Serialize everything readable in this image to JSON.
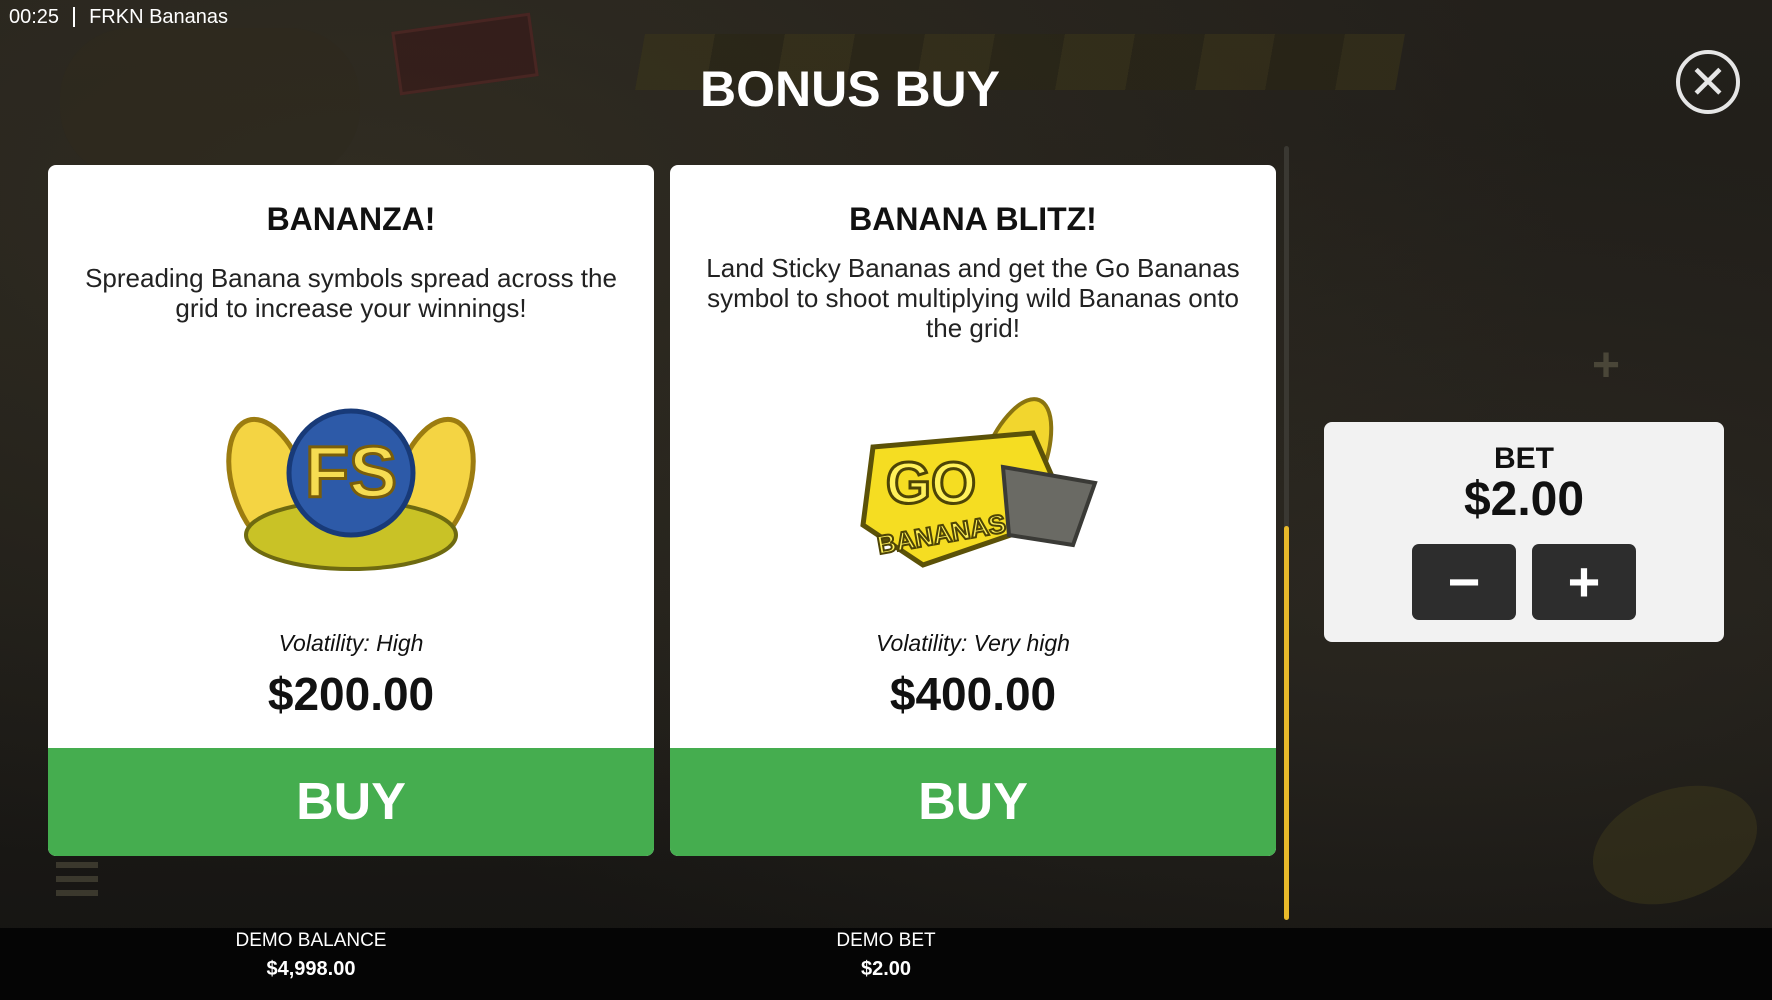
{
  "status_bar": {
    "time": "00:25",
    "app_title": "FRKN Bananas"
  },
  "modal": {
    "title": "BONUS BUY",
    "close_icon": "close-circle-icon"
  },
  "bonus_cards": [
    {
      "name": "BANANZA!",
      "description": "Spreading Banana symbols spread across the grid to increase your winnings!",
      "art_icon": "fs-banana-badge-icon",
      "art_text": "FS",
      "volatility": "Volatility: High",
      "price": "$200.00",
      "buy_label": "BUY"
    },
    {
      "name": "BANANA BLITZ!",
      "description": "Land Sticky Bananas and get the Go Bananas symbol to shoot multiplying wild Bananas onto the grid!",
      "art_icon": "go-bananas-badge-icon",
      "art_text": "GO",
      "art_subtext": "BANANAS",
      "volatility": "Volatility: Very high",
      "price": "$400.00",
      "buy_label": "BUY"
    }
  ],
  "bet_panel": {
    "label": "BET",
    "value": "$2.00",
    "minus_label": "−",
    "plus_label": "+"
  },
  "footer": {
    "balance_label": "DEMO BALANCE",
    "balance_value": "$4,998.00",
    "bet_label": "DEMO BET",
    "bet_value": "$2.00"
  },
  "colors": {
    "buy_green": "#45ad4f",
    "scroll_accent": "#e8b92a",
    "card_bg": "#ffffff",
    "bet_button": "#2d2d2d"
  }
}
